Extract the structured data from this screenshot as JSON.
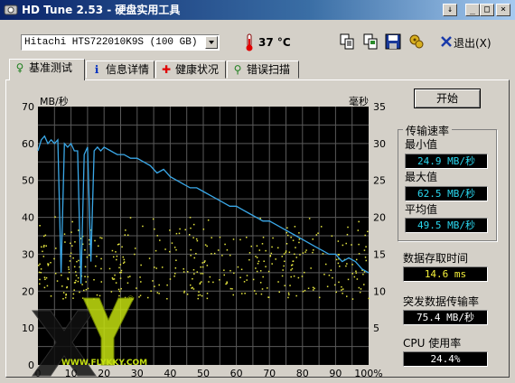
{
  "window": {
    "title": "HD Tune 2.53 - 硬盘实用工具",
    "caption_min": "_",
    "caption_max": "□",
    "caption_close": "×",
    "caption_extra": "↓"
  },
  "toolbar": {
    "drive": "Hitachi HTS722010K9S (100 GB)",
    "temperature": "37 °C",
    "exit_label": "退出(X)",
    "icons": [
      "copy-text-icon",
      "copy-screen-icon",
      "save-icon",
      "options-icon",
      "exit-icon"
    ]
  },
  "tabs": [
    {
      "label": "基准测试",
      "icon": "benchmark-icon",
      "active": true
    },
    {
      "label": "信息详情",
      "icon": "info-icon",
      "active": false
    },
    {
      "label": "健康状况",
      "icon": "health-cross-icon",
      "active": false
    },
    {
      "label": "错误扫描",
      "icon": "scan-magnifier-icon",
      "active": false
    }
  ],
  "side": {
    "start_label": "开始",
    "rate_title": "传输速率",
    "min_label": "最小值",
    "min_value": "24.9 MB/秒",
    "max_label": "最大值",
    "max_value": "62.5 MB/秒",
    "avg_label": "平均值",
    "avg_value": "49.5 MB/秒",
    "access_label": "数据存取时间",
    "access_value": "14.6 ms",
    "burst_label": "突发数据传输率",
    "burst_value": "75.4 MB/秒",
    "cpu_label": "CPU 使用率",
    "cpu_value": "24.4%"
  },
  "watermark": {
    "text": "WWW.FLYKKY.COM",
    "mark": "®"
  },
  "colors": {
    "title_start": "#0a246a",
    "title_end": "#a6caf0",
    "chart_bg": "#000000",
    "grid": "#5a5a5a",
    "transfer_line": "#3aa8e8",
    "access_points": "#e8e840",
    "value_cyan": "#2ad8f0",
    "value_yellow": "#f5f03a"
  },
  "chart_data": {
    "type": "line",
    "left_axis_label": "MB/秒",
    "right_axis_label": "毫秒",
    "y_ticks": [
      "70",
      "60",
      "50",
      "40",
      "30",
      "20",
      "10",
      "0"
    ],
    "y2_ticks": [
      "35",
      "30",
      "25",
      "20",
      "15",
      "10",
      "5"
    ],
    "x_ticks": [
      "0",
      "10",
      "20",
      "30",
      "40",
      "50",
      "60",
      "70",
      "80",
      "90",
      "100%"
    ],
    "ylim": [
      0,
      70
    ],
    "y2lim": [
      0,
      35
    ],
    "xlim": [
      0,
      100
    ],
    "grid": true,
    "series": [
      {
        "kind": "transfer_rate",
        "x": [
          0,
          1,
          2,
          3,
          4,
          5,
          6,
          7,
          8,
          9,
          10,
          11,
          12,
          13,
          14,
          15,
          16,
          17,
          18,
          19,
          20,
          22,
          24,
          26,
          28,
          30,
          32,
          34,
          36,
          38,
          40,
          42,
          44,
          46,
          48,
          50,
          52,
          54,
          56,
          58,
          60,
          62,
          64,
          66,
          68,
          70,
          72,
          74,
          76,
          78,
          80,
          82,
          84,
          86,
          88,
          90,
          92,
          94,
          96,
          98,
          100
        ],
        "y": [
          58,
          61,
          62,
          60,
          61,
          60,
          61,
          25,
          60,
          59,
          60,
          58,
          58,
          22,
          57,
          59,
          28,
          58,
          59,
          58,
          59,
          58,
          57,
          57,
          56,
          56,
          55,
          54,
          52,
          53,
          51,
          50,
          49,
          48,
          48,
          47,
          46,
          45,
          44,
          43,
          43,
          42,
          41,
          40,
          39,
          39,
          38,
          37,
          36,
          35,
          34,
          33,
          32,
          31,
          30,
          30,
          28,
          29,
          28,
          26,
          25
        ]
      }
    ],
    "access_time_scatter": {
      "description_range_ms": [
        9,
        21
      ]
    }
  }
}
